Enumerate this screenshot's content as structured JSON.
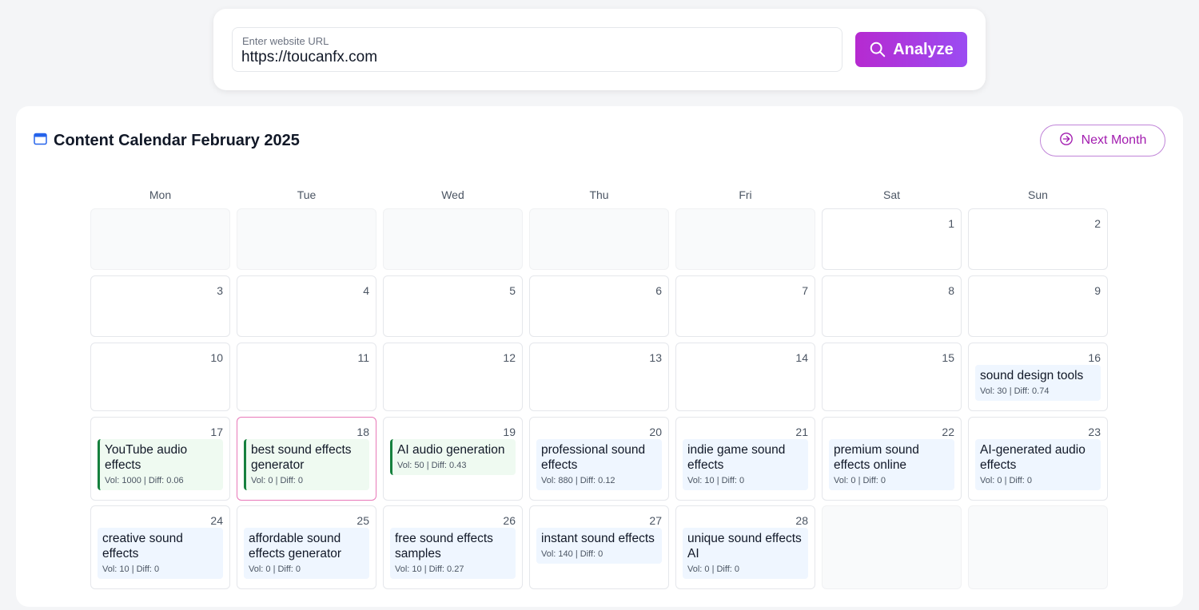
{
  "search": {
    "label": "Enter website URL",
    "value": "https://toucanfx.com",
    "button_label": "Analyze"
  },
  "calendar": {
    "title": "Content Calendar February 2025",
    "next_label": "Next Month",
    "weekdays": [
      "Mon",
      "Tue",
      "Wed",
      "Thu",
      "Fri",
      "Sat",
      "Sun"
    ],
    "days": [
      {
        "num": "1"
      },
      {
        "num": "2"
      },
      {
        "num": "3"
      },
      {
        "num": "4"
      },
      {
        "num": "5"
      },
      {
        "num": "6"
      },
      {
        "num": "7"
      },
      {
        "num": "8"
      },
      {
        "num": "9"
      },
      {
        "num": "10"
      },
      {
        "num": "11"
      },
      {
        "num": "12"
      },
      {
        "num": "13"
      },
      {
        "num": "14"
      },
      {
        "num": "15"
      },
      {
        "num": "16",
        "keyword": "sound design tools",
        "meta": "Vol: 30 | Diff: 0.74"
      },
      {
        "num": "17",
        "keyword": "YouTube audio effects",
        "meta": "Vol: 1000 | Diff: 0.06"
      },
      {
        "num": "18",
        "keyword": "best sound effects generator",
        "meta": "Vol: 0 | Diff: 0"
      },
      {
        "num": "19",
        "keyword": "AI audio generation",
        "meta": "Vol: 50 | Diff: 0.43"
      },
      {
        "num": "20",
        "keyword": "professional sound effects",
        "meta": "Vol: 880 | Diff: 0.12"
      },
      {
        "num": "21",
        "keyword": "indie game sound effects",
        "meta": "Vol: 10 | Diff: 0"
      },
      {
        "num": "22",
        "keyword": "premium sound effects online",
        "meta": "Vol: 0 | Diff: 0"
      },
      {
        "num": "23",
        "keyword": "AI-generated audio effects",
        "meta": "Vol: 0 | Diff: 0"
      },
      {
        "num": "24",
        "keyword": "creative sound effects",
        "meta": "Vol: 10 | Diff: 0"
      },
      {
        "num": "25",
        "keyword": "affordable sound effects generator",
        "meta": "Vol: 0 | Diff: 0"
      },
      {
        "num": "26",
        "keyword": "free sound effects samples",
        "meta": "Vol: 10 | Diff: 0.27"
      },
      {
        "num": "27",
        "keyword": "instant sound effects",
        "meta": "Vol: 140 | Diff: 0"
      },
      {
        "num": "28",
        "keyword": "unique sound effects AI",
        "meta": "Vol: 0 | Diff: 0"
      }
    ]
  },
  "colors": {
    "accent": "#a21caf",
    "entry_blue": "#eff6ff",
    "entry_green": "#effaf1",
    "green_bar": "#15803d"
  }
}
